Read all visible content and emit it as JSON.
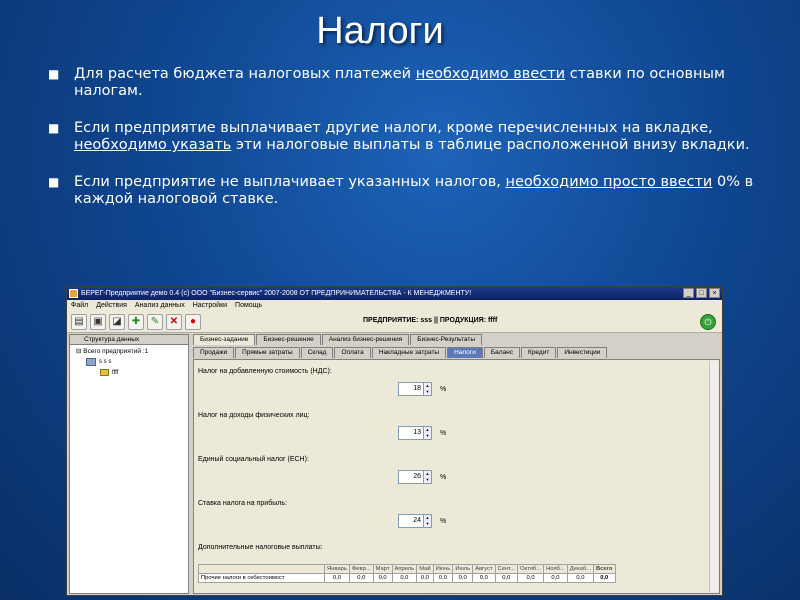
{
  "slide": {
    "title": "Налоги",
    "bullets": [
      {
        "pre": "Для расчета бюджета налоговых платежей ",
        "u": "необходимо ввести",
        "post": " ставки по основным налогам."
      },
      {
        "pre": "Если предприятие выплачивает другие налоги, кроме перечисленных на вкладке, ",
        "u": "необходимо указать",
        "post": " эти налоговые выплаты в таблице расположенной внизу вкладки."
      },
      {
        "pre": "Если предприятие не выплачивает указанных налогов, ",
        "u": "необходимо просто ввести",
        "post": " 0% в каждой налоговой ставке."
      }
    ]
  },
  "window": {
    "title": "БЕРЕГ-Предприятие демо 0.4   (c) ООО \"Бизнес-сервис\" 2007-2008   ОТ ПРЕДПРИНИМАТЕЛЬСТВА - К МЕНЕДЖМЕНТУ!",
    "menu": [
      "Файл",
      "Действия",
      "Анализ данных",
      "Настройки",
      "Помощь"
    ],
    "enterprise_line": "ПРЕДПРИЯТИЕ: sss  ||  ПРОДУКЦИЯ: ffff",
    "tree": {
      "header": "Структура данных",
      "root": "Всего предприятий :1",
      "node": "s s s",
      "child": "ffff"
    },
    "tabs": [
      "Бизнес-задание",
      "Бизнес-решение",
      "Анализ бизнес-решения",
      "Бизнес-Результаты"
    ],
    "subtabs": [
      "Продажи",
      "Прямые затраты",
      "Склад",
      "Оплата",
      "Накладные затраты",
      "Налоги",
      "Баланс",
      "Кредит",
      "Инвестиции"
    ],
    "fields": [
      {
        "label": "Налог на добавленную стоимость (НДС):",
        "value": "18",
        "unit": "%"
      },
      {
        "label": "Налог на доходы физических лиц:",
        "value": "13",
        "unit": "%"
      },
      {
        "label": "Единый социальный налог (ЕСН):",
        "value": "26",
        "unit": "%"
      },
      {
        "label": "Ставка налога на прибыль:",
        "value": "24",
        "unit": "%"
      }
    ],
    "additional_label": "Дополнительные налоговые выплаты:",
    "table": {
      "headers": [
        "",
        "Январь",
        "Февр...",
        "Март",
        "Апрель",
        "Май",
        "Июнь",
        "Июль",
        "Август",
        "Сент...",
        "Октяб...",
        "Нояб...",
        "Декаб...",
        "Всего"
      ],
      "row": [
        "Прочие налоги в себестоимост",
        "0,0",
        "0,0",
        "0,0",
        "0,0",
        "0,0",
        "0,0",
        "0,0",
        "0,0",
        "0,0",
        "0,0",
        "0,0",
        "0,0",
        "0,0"
      ]
    }
  }
}
